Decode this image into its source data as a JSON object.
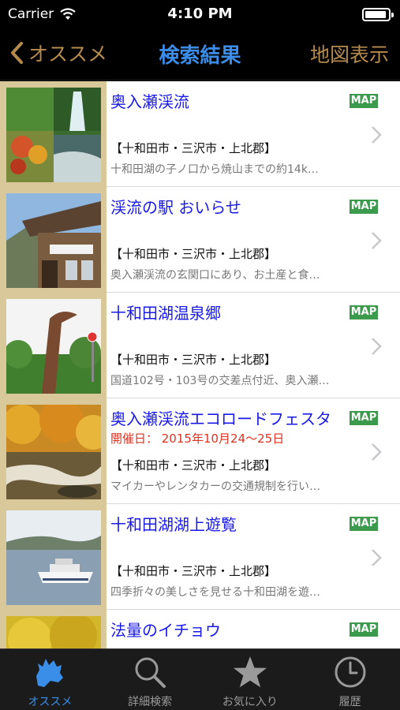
{
  "status": {
    "carrier": "Carrier",
    "time": "4:10 PM"
  },
  "nav": {
    "back_label": "オススメ",
    "title": "検索結果",
    "right_label": "地図表示"
  },
  "results": [
    {
      "title": "奥入瀬渓流",
      "date": "",
      "area": "【十和田市・三沢市・上北郡】",
      "desc": "十和田湖の子ノ口から焼山までの約14k…",
      "map": "MAP",
      "image": "waterfall"
    },
    {
      "title": "渓流の駅 おいらせ",
      "date": "",
      "area": "【十和田市・三沢市・上北郡】",
      "desc": "奥入瀬渓流の玄関口にあり、お土産と食…",
      "map": "MAP",
      "image": "station"
    },
    {
      "title": "十和田湖温泉郷",
      "date": "",
      "area": "【十和田市・三沢市・上北郡】",
      "desc": "国道102号・103号の交差点付近、奥入瀬…",
      "map": "MAP",
      "image": "monument"
    },
    {
      "title": "奥入瀬渓流エコロードフェスタ",
      "date": "開催日： 2015年10月24〜25日",
      "area": "【十和田市・三沢市・上北郡】",
      "desc": "マイカーやレンタカーの交通規制を行い…",
      "map": "MAP",
      "image": "autumn-stream"
    },
    {
      "title": "十和田湖湖上遊覧",
      "date": "",
      "area": "【十和田市・三沢市・上北郡】",
      "desc": "四季折々の美しさを見せる十和田湖を遊…",
      "map": "MAP",
      "image": "boat"
    },
    {
      "title": "法量のイチョウ",
      "date": "",
      "area": "",
      "desc": "",
      "map": "MAP",
      "image": "ginkgo"
    }
  ],
  "tabs": [
    {
      "label": "オススメ",
      "icon": "region-map-icon",
      "active": true
    },
    {
      "label": "詳細検索",
      "icon": "search-icon",
      "active": false
    },
    {
      "label": "お気に入り",
      "icon": "star-icon",
      "active": false
    },
    {
      "label": "履歴",
      "icon": "clock-icon",
      "active": false
    }
  ],
  "colors": {
    "accent": "#3b8de9",
    "nav_gold": "#b48b4d",
    "title_blue": "#1a1ae8",
    "date_red": "#e0321f",
    "map_green": "#3c9a4c"
  }
}
